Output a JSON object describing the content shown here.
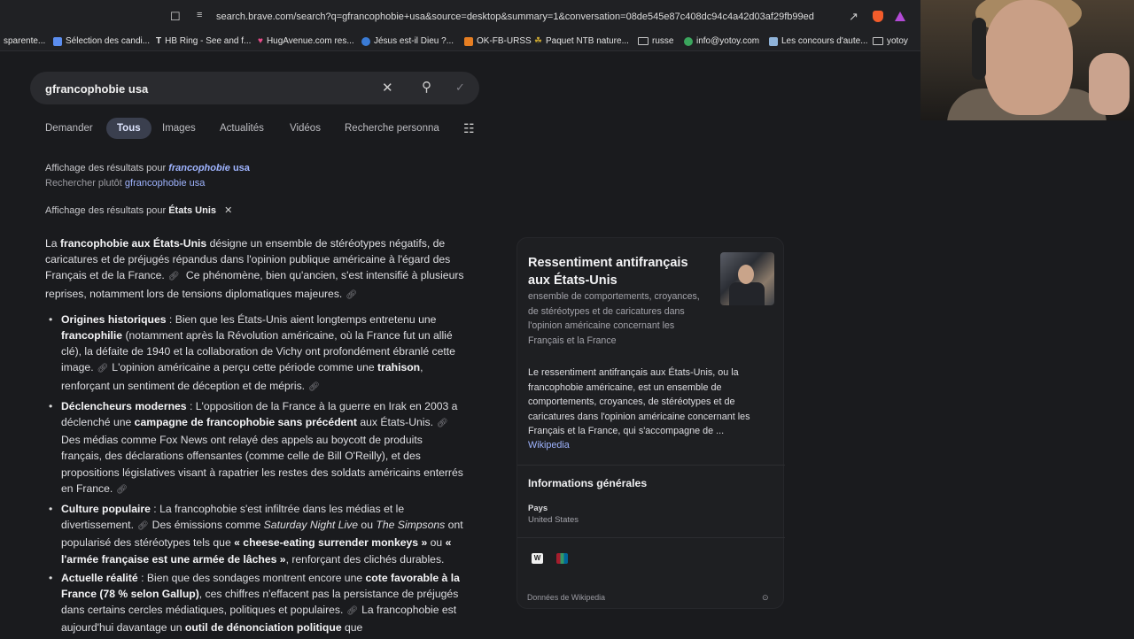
{
  "browser": {
    "url": "search.brave.com/search?q=gfrancophobie+usa&source=desktop&summary=1&conversation=08de545e87c408dc94c4a42d03af29fb99ed"
  },
  "bookmarks": [
    {
      "label": "sparente...",
      "icon": "page-icon",
      "color": "#202124"
    },
    {
      "label": "Sélection des candi...",
      "icon": "doc-icon",
      "color": "#5b8def"
    },
    {
      "label": "HB Ring - See and f...",
      "icon": "t-icon",
      "color": "#e8e8e8"
    },
    {
      "label": "HugAvenue.com res...",
      "icon": "heart-icon",
      "color": "#e94b8a"
    },
    {
      "label": "Jésus est-il Dieu ?...",
      "icon": "circle-icon",
      "color": "#3a7bd5"
    },
    {
      "label": "OK-FB-URSS",
      "icon": "b-icon",
      "color": "#e67e22"
    },
    {
      "label": "Paquet NTB nature...",
      "icon": "leaf-icon",
      "color": "#c8a531"
    },
    {
      "label": "russe",
      "icon": "folder-icon",
      "color": "#c8c8c8"
    },
    {
      "label": "info@yotoy.com",
      "icon": "globe-icon",
      "color": "#3ba55d"
    },
    {
      "label": "Les concours d'aute...",
      "icon": "image-icon",
      "color": "#8fb3d9"
    },
    {
      "label": "yotoy",
      "icon": "folder-icon",
      "color": "#c8c8c8"
    }
  ],
  "search": {
    "query": "gfrancophobie usa"
  },
  "tabs": [
    "Demander",
    "Tous",
    "Images",
    "Actualités",
    "Vidéos",
    "Recherche personna"
  ],
  "correction": {
    "showing_prefix": "Affichage des résultats pour ",
    "showing_query_italic": "francophobie",
    "showing_query_rest": " usa",
    "instead_prefix": "Rechercher plutôt ",
    "instead_query": "gfrancophobie usa",
    "entity_prefix": "Affichage des résultats pour ",
    "entity": "États Unis"
  },
  "answer": {
    "intro": [
      {
        "t": "La ",
        "b": false
      },
      {
        "t": "francophobie aux États-Unis",
        "b": true
      },
      {
        "t": " désigne un ensemble de stéréotypes négatifs, de caricatures et de préjugés répandus dans l'opinion publique américaine à l'égard des Français et de la France.",
        "b": false
      },
      {
        "t": " Ce phénomène, bien qu'ancien, s'est intensifié à plusieurs reprises, notamment lors de tensions diplomatiques majeures.",
        "b": false
      }
    ],
    "bullets": [
      {
        "title": "Origines historiques",
        "parts": [
          {
            "t": "Bien que les États-Unis aient longtemps entretenu une ",
            "s": "n"
          },
          {
            "t": "francophilie",
            "s": "b"
          },
          {
            "t": " (notamment après la Révolution américaine, où la France fut un allié clé), la défaite de 1940 et la collaboration de Vichy ont profondément ébranlé cette image.",
            "s": "n"
          },
          {
            "t": "L'opinion américaine a perçu cette période comme une ",
            "s": "n"
          },
          {
            "t": "trahison",
            "s": "b"
          },
          {
            "t": ", renforçant un sentiment de déception et de mépris.",
            "s": "n"
          }
        ]
      },
      {
        "title": "Déclencheurs modernes",
        "parts": [
          {
            "t": "L'opposition de la France à la guerre en Irak en 2003 a déclenché une ",
            "s": "n"
          },
          {
            "t": "campagne de francophobie sans précédent",
            "s": "b"
          },
          {
            "t": " aux États-Unis.",
            "s": "n"
          },
          {
            "t": "Des médias comme Fox News ont relayé des appels au boycott de produits français, des déclarations offensantes (comme celle de Bill O'Reilly), et des propositions législatives visant à rapatrier les restes des soldats américains enterrés en France.",
            "s": "n"
          }
        ]
      },
      {
        "title": "Culture populaire",
        "parts": [
          {
            "t": "La francophobie s'est infiltrée dans les médias et le divertissement.",
            "s": "n"
          },
          {
            "t": "Des émissions comme ",
            "s": "n"
          },
          {
            "t": "Saturday Night Live",
            "s": "i"
          },
          {
            "t": " ou ",
            "s": "n"
          },
          {
            "t": "The Simpsons",
            "s": "i"
          },
          {
            "t": " ont popularisé des stéréotypes tels que ",
            "s": "n"
          },
          {
            "t": "« cheese-eating surrender monkeys »",
            "s": "b"
          },
          {
            "t": " ou ",
            "s": "n"
          },
          {
            "t": "« l'armée française est une armée de lâches »",
            "s": "b"
          },
          {
            "t": ", renforçant des clichés durables.",
            "s": "n"
          }
        ]
      },
      {
        "title": "Actuelle réalité",
        "parts": [
          {
            "t": "Bien que des sondages montrent encore une ",
            "s": "n"
          },
          {
            "t": "cote favorable à la France (78 % selon Gallup)",
            "s": "b"
          },
          {
            "t": ", ces chiffres n'effacent pas la persistance de préjugés dans certains cercles médiatiques, politiques et populaires.",
            "s": "n"
          },
          {
            "t": "La francophobie est aujourd'hui davantage un ",
            "s": "n"
          },
          {
            "t": "outil de dénonciation politique",
            "s": "b"
          },
          {
            "t": " que",
            "s": "n"
          }
        ]
      }
    ]
  },
  "card": {
    "title": "Ressentiment antifrançais aux États-Unis",
    "subtitle": "ensemble de comportements, croyances, de stéréotypes et de caricatures dans l'opinion américaine concernant les Français et la France",
    "description": "Le ressentiment antifrançais aux États-Unis, ou la francophobie américaine, est un ensemble de comportements, croyances, de stéréotypes et de caricatures dans l'opinion américaine concernant les Français et la France, qui s'accompagne de ...",
    "source_link": "Wikipedia",
    "section": "Informations générales",
    "field_label": "Pays",
    "field_value": "United States",
    "footer": "Données de Wikipedia"
  }
}
